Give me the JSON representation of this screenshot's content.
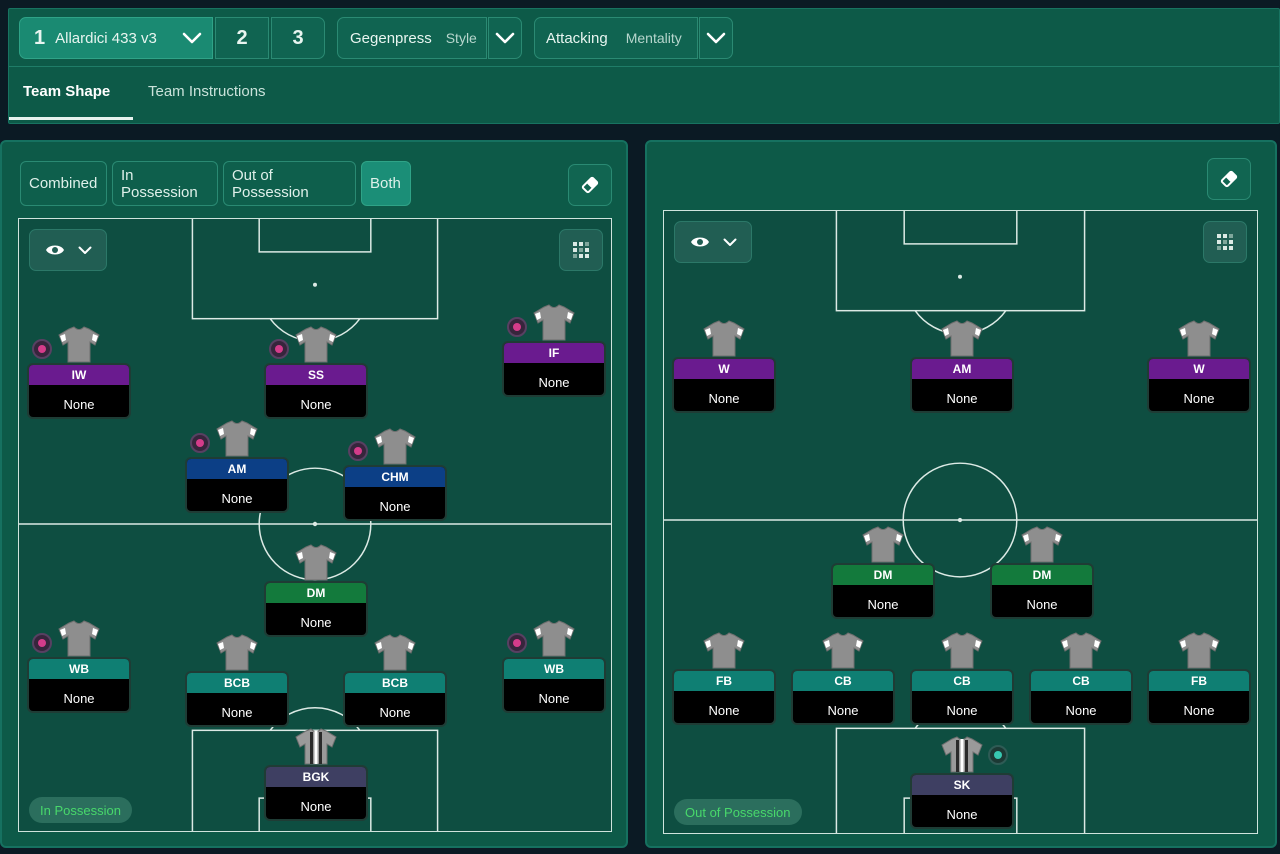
{
  "topbar": {
    "tactic_number": "1",
    "tactic_name": "Allardici 433 v3",
    "slot2": "2",
    "slot3": "3",
    "style_value": "Gegenpress",
    "style_label": "Style",
    "mentality_value": "Attacking",
    "mentality_label": "Mentality"
  },
  "tabs": {
    "team_shape": "Team Shape",
    "team_instructions": "Team Instructions"
  },
  "modes": {
    "combined": "Combined",
    "in_possession": "In Possession",
    "out_of_possession": "Out of Possession",
    "both": "Both"
  },
  "left_pitch": {
    "badge": "In Possession",
    "players": [
      {
        "role": "IW",
        "duty": "None"
      },
      {
        "role": "SS",
        "duty": "None"
      },
      {
        "role": "IF",
        "duty": "None"
      },
      {
        "role": "AM",
        "duty": "None"
      },
      {
        "role": "CHM",
        "duty": "None"
      },
      {
        "role": "DM",
        "duty": "None"
      },
      {
        "role": "WB",
        "duty": "None"
      },
      {
        "role": "BCB",
        "duty": "None"
      },
      {
        "role": "BCB",
        "duty": "None"
      },
      {
        "role": "WB",
        "duty": "None"
      },
      {
        "role": "BGK",
        "duty": "None"
      }
    ]
  },
  "right_pitch": {
    "badge": "Out of Possession",
    "players": [
      {
        "role": "W",
        "duty": "None"
      },
      {
        "role": "AM",
        "duty": "None"
      },
      {
        "role": "W",
        "duty": "None"
      },
      {
        "role": "DM",
        "duty": "None"
      },
      {
        "role": "DM",
        "duty": "None"
      },
      {
        "role": "FB",
        "duty": "None"
      },
      {
        "role": "CB",
        "duty": "None"
      },
      {
        "role": "CB",
        "duty": "None"
      },
      {
        "role": "CB",
        "duty": "None"
      },
      {
        "role": "FB",
        "duty": "None"
      },
      {
        "role": "SK",
        "duty": "None"
      }
    ]
  },
  "colors": {
    "attack": "#6a1b8f",
    "midfield": "#0c3f86",
    "defensive_mid": "#137a3c",
    "defence": "#0f7f73",
    "goalkeeper": "#3e3f62",
    "accent": "#1b8e77"
  },
  "icons": {
    "tactic_dropdown": "chevron-down-icon",
    "style_dropdown": "chevron-down-icon",
    "mentality_dropdown": "chevron-down-icon",
    "eraser": "eraser-icon",
    "view": "eye-icon",
    "grid": "grid-icon",
    "shirt": "shirt-icon",
    "instruction_marker": "instruction-marker-icon"
  }
}
